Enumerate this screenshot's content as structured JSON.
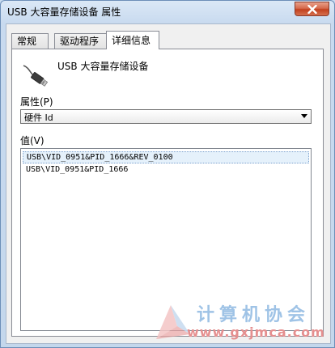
{
  "window": {
    "title": "USB 大容量存储设备 属性"
  },
  "tabs": [
    {
      "label": "常规"
    },
    {
      "label": "驱动程序"
    },
    {
      "label": "详细信息"
    }
  ],
  "device": {
    "name": "USB 大容量存储设备",
    "icon": "usb-plug-icon"
  },
  "property": {
    "label": "属性(P)",
    "selected": "硬件 Id"
  },
  "values": {
    "label": "值(V)",
    "items": [
      "USB\\VID_0951&PID_1666&REV_0100",
      "USB\\VID_0951&PID_1666"
    ]
  },
  "watermark": {
    "text": "计算机协会",
    "url": "www.gxjmca.com"
  },
  "colors": {
    "close_button": "#c2411e",
    "selection": "#e5f1fb",
    "watermark_text": "#9fc3e6",
    "watermark_url": "#e58f8f"
  }
}
